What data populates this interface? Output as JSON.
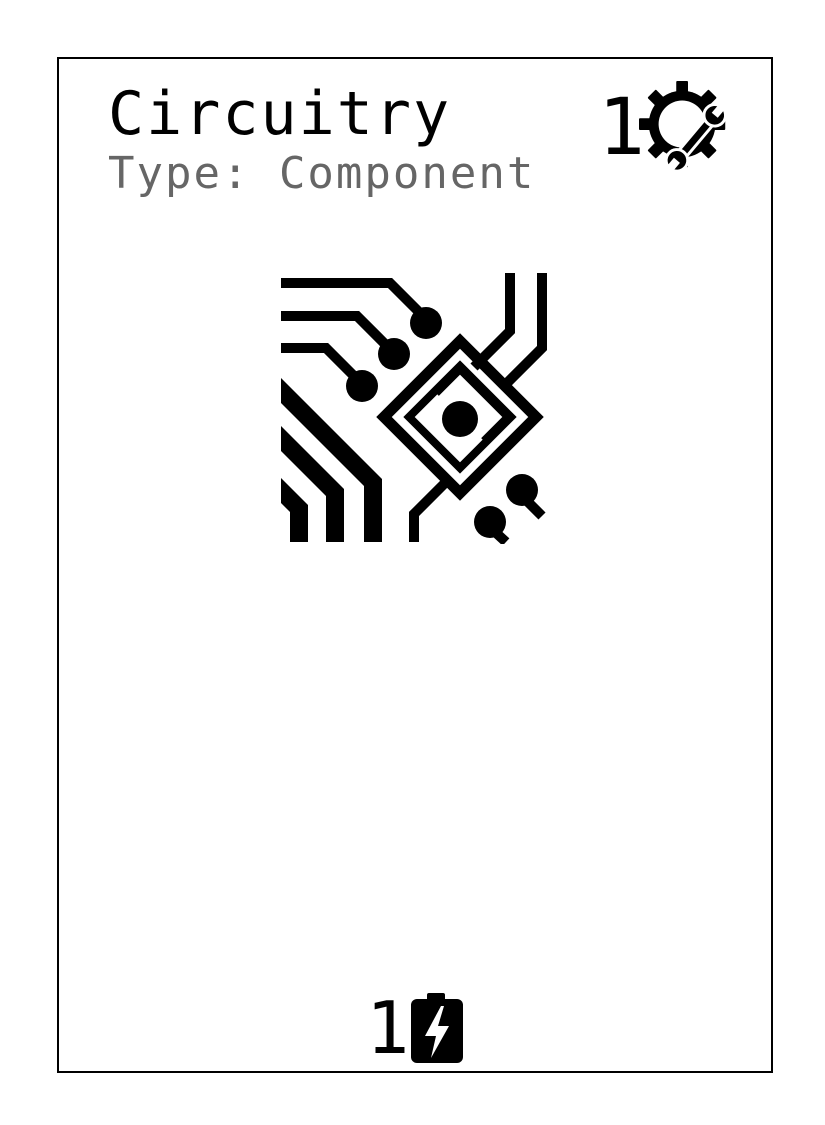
{
  "card": {
    "title": "Circuitry",
    "type_line": "Type: Component",
    "cost": {
      "value": "1",
      "icon": "gear-wrench-icon"
    },
    "art": {
      "icon": "circuit-board-icon"
    },
    "energy": {
      "value": "1",
      "icon": "battery-bolt-icon"
    },
    "colors": {
      "text": "#000000",
      "subtitle": "#666666",
      "background": "#ffffff"
    }
  }
}
